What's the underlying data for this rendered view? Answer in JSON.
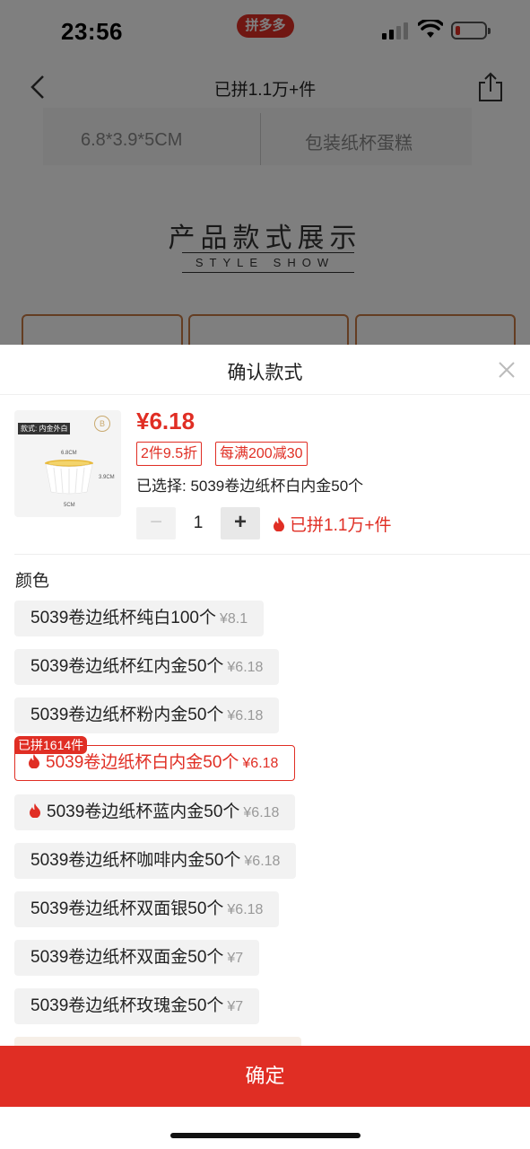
{
  "status_bar": {
    "time": "23:56",
    "app_badge": "拼多多"
  },
  "nav": {
    "title": "已拼1.1万+件"
  },
  "background": {
    "spec_left": "6.8*3.9*5CM",
    "spec_right": "包装纸杯蛋糕",
    "section_title": "产品款式展示",
    "section_subtitle": "STYLE SHOW"
  },
  "sheet": {
    "title": "确认款式",
    "thumbnail": {
      "tag": "款式: 内金外白",
      "dim_top": "6.8CM",
      "dim_side": "3.9CM",
      "dim_bottom": "5CM"
    },
    "price": "¥6.18",
    "tags": [
      "2件9.5折",
      "每满200减30"
    ],
    "selected": "已选择: 5039卷边纸杯白内金50个",
    "quantity": "1",
    "minus": "−",
    "plus": "+",
    "joined": "已拼1.1万+件",
    "color_label": "颜色",
    "selected_badge": "已拼1614件",
    "options": [
      {
        "label": "5039卷边纸杯纯白100个",
        "price": "¥8.1"
      },
      {
        "label": "5039卷边纸杯红内金50个",
        "price": "¥6.18"
      },
      {
        "label": "5039卷边纸杯粉内金50个",
        "price": "¥6.18"
      },
      {
        "label": "5039卷边纸杯白内金50个",
        "price": "¥6.18"
      },
      {
        "label": "5039卷边纸杯蓝内金50个",
        "price": "¥6.18"
      },
      {
        "label": "5039卷边纸杯咖啡内金50个",
        "price": "¥6.18"
      },
      {
        "label": "5039卷边纸杯双面银50个",
        "price": "¥6.18"
      },
      {
        "label": "5039卷边纸杯双面金50个",
        "price": "¥7"
      },
      {
        "label": "5039卷边纸杯玫瑰金50个",
        "price": "¥7"
      }
    ],
    "confirm": "确定"
  },
  "colors": {
    "accent": "#e02e24",
    "option_bg": "#f2f2f2"
  },
  "icons": [
    "back-icon",
    "share-icon",
    "close-icon",
    "flame-icon",
    "wifi-icon",
    "battery-icon",
    "signal-icon"
  ]
}
